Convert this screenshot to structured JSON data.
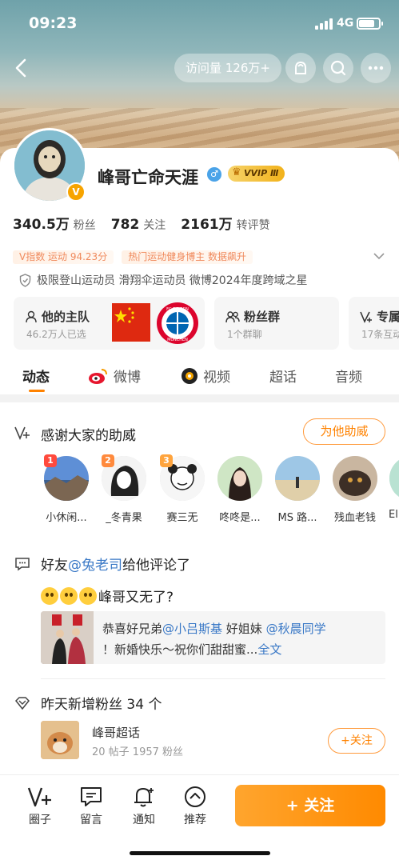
{
  "status_bar": {
    "time": "09:23",
    "network": "4G"
  },
  "header": {
    "visits": "访问量 126万+"
  },
  "profile": {
    "name": "峰哥亡命天涯",
    "vip_badge": "VVIP Ⅲ",
    "avatar_badge": "V",
    "stats": [
      {
        "num": "340.5万",
        "label": "粉丝"
      },
      {
        "num": "782",
        "label": "关注"
      },
      {
        "num": "2161万",
        "label": "转评赞"
      }
    ],
    "tags": [
      "V指数 运动 94.23分",
      "热门运动健身博主 数据飙升"
    ],
    "verification": "极限登山运动员 滑翔伞运动员 微博2024年度跨域之星"
  },
  "panels": {
    "team": {
      "title": "他的主队",
      "sub": "46.2万人已选",
      "fcb": "FC BAYERN MÜNCHEN"
    },
    "fans_group": {
      "title": "粉丝群",
      "sub": "1个群聊"
    },
    "third": {
      "title": "专属",
      "sub": "17条互动"
    }
  },
  "tabs": [
    "动态",
    "微博",
    "视频",
    "超话",
    "音频"
  ],
  "support": {
    "title": "感谢大家的助威",
    "button": "为他助威",
    "fans": [
      {
        "label": "小休闲...",
        "rank": "1"
      },
      {
        "label": "_冬青果",
        "rank": "2"
      },
      {
        "label": "赛三无",
        "rank": "3"
      },
      {
        "label": "咚咚是..."
      },
      {
        "label": "MS 路..."
      },
      {
        "label": "残血老钱"
      },
      {
        "label": "El"
      }
    ]
  },
  "friend_comment": {
    "prefix": "好友",
    "mention": "@兔老司",
    "suffix": "给他评论了",
    "comment": "峰哥又无了?",
    "quote": {
      "t1": "恭喜好兄弟",
      "m1": "@小吕斯基",
      "t2": " 好姐妹 ",
      "m2": "@秋晨同学",
      "t3": "！新婚快乐～祝你们甜甜蜜...",
      "more": "全文"
    }
  },
  "new_fans": {
    "title": "昨天新增粉丝 34 个"
  },
  "super_topic": {
    "title": "峰哥超话",
    "sub": "20 帖子 1957 粉丝",
    "button": "+关注"
  },
  "bottom_bar": {
    "items": [
      "圈子",
      "留言",
      "通知",
      "推荐"
    ],
    "follow": "+ 关注"
  },
  "colors": {
    "accent": "#ff8200",
    "link": "#3978c6"
  }
}
